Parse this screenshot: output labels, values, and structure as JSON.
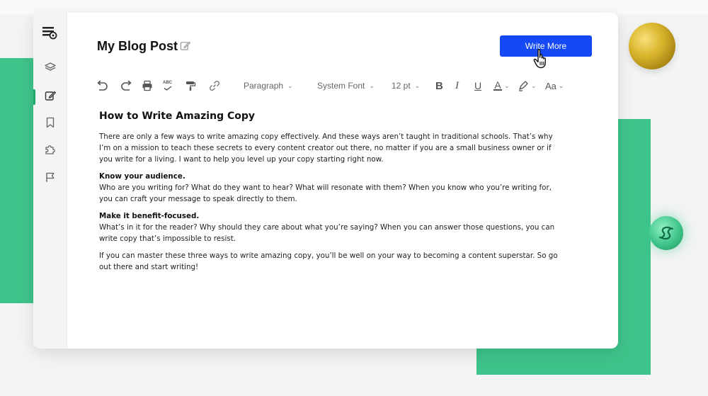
{
  "app": {
    "title": "My Blog Post",
    "write_more_label": "Write More"
  },
  "sidebar": {
    "items": [
      {
        "name": "layers",
        "icon": "layers-icon"
      },
      {
        "name": "edit",
        "icon": "edit-icon",
        "active": true
      },
      {
        "name": "bookmark",
        "icon": "bookmark-icon"
      },
      {
        "name": "plugins",
        "icon": "puzzle-icon"
      },
      {
        "name": "flag",
        "icon": "flag-icon"
      }
    ]
  },
  "toolbar": {
    "paragraph": "Paragraph",
    "font": "System Font",
    "size": "12 pt",
    "bold": "B",
    "italic": "I",
    "underline": "U",
    "text_color": "A",
    "font_case": "Aa",
    "spellcheck": "ABC"
  },
  "document": {
    "heading": "How to Write Amazing Copy",
    "p1": "There are only a few ways to write amazing copy effectively. And these ways aren’t taught in traditional schools. That’s why I’m on a mission to teach these secrets to every content creator out there, no matter if you are a small business owner or if you write for a living. I want to help you level up your copy starting right now.",
    "s1_title": "Know your audience.",
    "s1_body": "Who are you writing for? What do they want to hear? What will resonate with them? When you know who you’re writing for, you can craft your message to speak directly to them.",
    "s2_title": "Make it benefit-focused.",
    "s2_body": "What’s in it for the reader? Why should they care about what you’re saying? When you can answer those questions, you can write copy that’s impossible to resist.",
    "p_final": "If you can master these three ways to write amazing copy, you’ll be well on your way to becoming a content superstar. So go out there and start writing!"
  },
  "colors": {
    "accent_blue": "#1549f5",
    "brand_green": "#3ec48a",
    "active_indicator": "#19a866"
  }
}
